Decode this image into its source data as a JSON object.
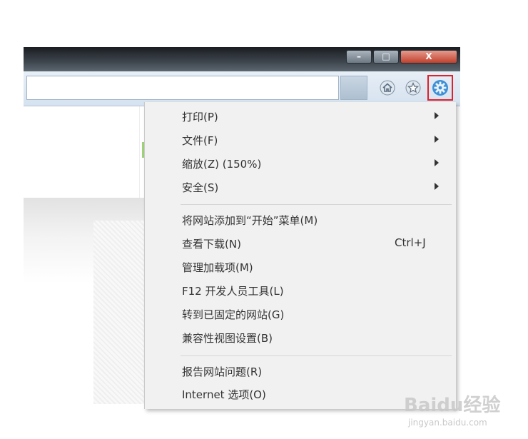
{
  "window": {
    "minimize_glyph": "–",
    "maximize_glyph": "□",
    "close_glyph": "X"
  },
  "toolbar": {
    "address_value": "",
    "icons": [
      "home-icon",
      "star-icon",
      "gear-icon"
    ],
    "gear_highlight_color": "#e0202a"
  },
  "menu": {
    "groups": [
      {
        "items": [
          {
            "label": "打印(P)",
            "submenu": true
          },
          {
            "label": "文件(F)",
            "submenu": true
          },
          {
            "label": "缩放(Z) (150%)",
            "submenu": true
          },
          {
            "label": "安全(S)",
            "submenu": true
          }
        ]
      },
      {
        "items": [
          {
            "label": "将网站添加到“开始”菜单(M)"
          },
          {
            "label": "查看下载(N)",
            "shortcut": "Ctrl+J"
          },
          {
            "label": "管理加载项(M)"
          },
          {
            "label": "F12 开发人员工具(L)"
          },
          {
            "label": "转到已固定的网站(G)"
          },
          {
            "label": "兼容性视图设置(B)"
          }
        ]
      },
      {
        "items": [
          {
            "label": "报告网站问题(R)"
          },
          {
            "label": "Internet 选项(O)"
          }
        ]
      }
    ]
  },
  "watermark": {
    "brand": "Baidu经验",
    "url": "jingyan.baidu.com"
  }
}
